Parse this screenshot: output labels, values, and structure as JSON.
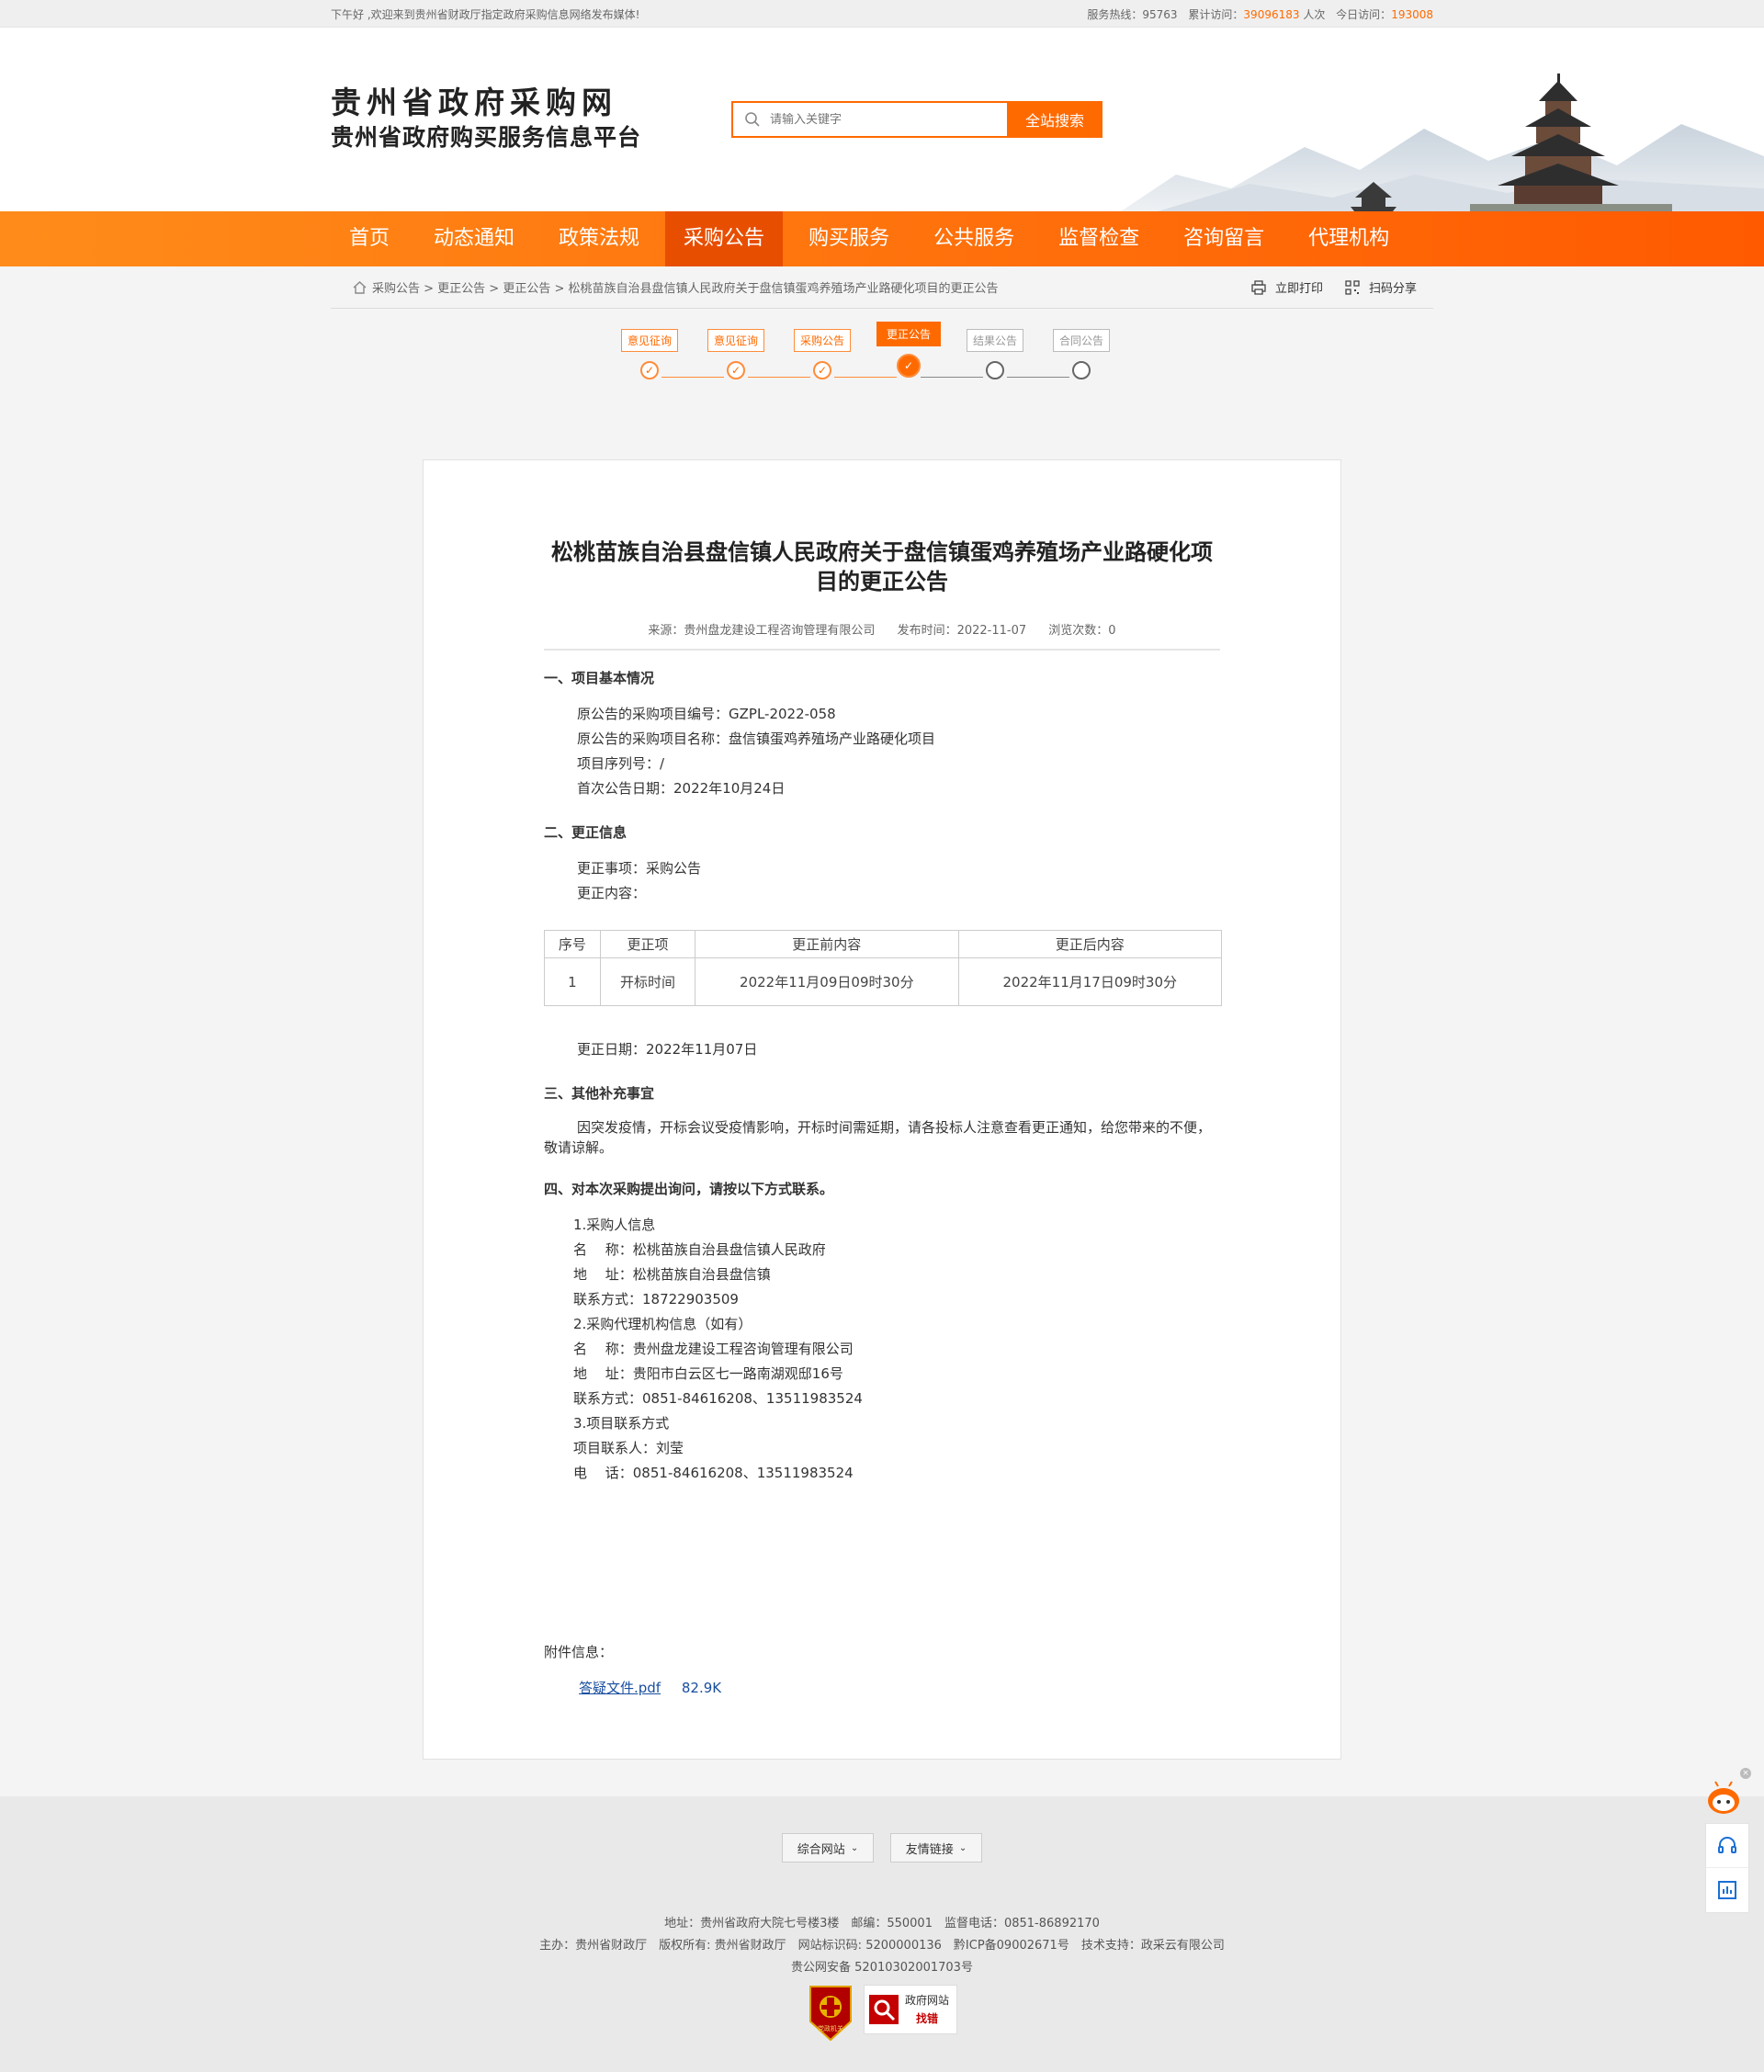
{
  "topbar": {
    "welcome": "下午好 ,欢迎来到贵州省财政厅指定政府采购信息网络发布媒体!",
    "hotline_label": "服务热线：95763",
    "total_label": "累计访问：",
    "total_value": "39096183",
    "total_unit": "人次",
    "today_label": "今日访问：",
    "today_value": "193008"
  },
  "header": {
    "title1": "贵州省政府采购网",
    "title2": "贵州省政府购买服务信息平台",
    "search_placeholder": "请输入关键字",
    "search_button": "全站搜索"
  },
  "nav": {
    "items": [
      "首页",
      "动态通知",
      "政策法规",
      "采购公告",
      "购买服务",
      "公共服务",
      "监督检查",
      "咨询留言",
      "代理机构"
    ],
    "active_index": 3
  },
  "breadcrumb": {
    "path": "采购公告 > 更正公告 > 更正公告 > 松桃苗族自治县盘信镇人民政府关于盘信镇蛋鸡养殖场产业路硬化项目的更正公告",
    "print": "立即打印",
    "share": "扫码分享"
  },
  "progress": {
    "steps": [
      "意见征询",
      "意见征询",
      "采购公告",
      "更正公告",
      "结果公告",
      "合同公告"
    ],
    "current_index": 3,
    "done_count": 3
  },
  "article": {
    "title": "松桃苗族自治县盘信镇人民政府关于盘信镇蛋鸡养殖场产业路硬化项目的更正公告",
    "source": "来源：贵州盘龙建设工程咨询管理有限公司",
    "publish_time": "发布时间：2022-11-07",
    "views": "浏览次数：0",
    "s1_title": "一、项目基本情况",
    "s1_lines": [
      "原公告的采购项目编号：GZPL-2022-058",
      "原公告的采购项目名称：盘信镇蛋鸡养殖场产业路硬化项目",
      "项目序列号：/",
      "首次公告日期：2022年10月24日"
    ],
    "s2_title": "二、更正信息",
    "s2_lines": [
      "更正事项：采购公告",
      "更正内容："
    ],
    "table": {
      "headers": [
        "序号",
        "更正项",
        "更正前内容",
        "更正后内容"
      ],
      "row": [
        "1",
        "开标时间",
        "2022年11月09日09时30分",
        "2022年11月17日09时30分"
      ]
    },
    "change_date": "更正日期：2022年11月07日",
    "s3_title": "三、其他补充事宜",
    "s3_text": "因突发疫情，开标会议受疫情影响，开标时间需延期，请各投标人注意查看更正通知，给您带来的不便，敬请谅解。",
    "s4_title": "四、对本次采购提出询问，请按以下方式联系。",
    "s4_lines": [
      "1.采购人信息",
      "名　 称：松桃苗族自治县盘信镇人民政府",
      "地　 址：松桃苗族自治县盘信镇",
      "联系方式：18722903509",
      "2.采购代理机构信息（如有）",
      "名　 称：贵州盘龙建设工程咨询管理有限公司",
      "地　 址：贵阳市白云区七一路南湖观邸16号",
      "联系方式：0851-84616208、13511983524",
      "3.项目联系方式",
      "项目联系人：刘莹",
      "电　 话：0851-84616208、13511983524"
    ],
    "attach_label": "附件信息：",
    "attach_name": "答疑文件.pdf",
    "attach_size": "82.9K"
  },
  "footer": {
    "drop1": "综合网站",
    "drop2": "友情链接",
    "line1": "地址：贵州省政府大院七号楼3楼　邮编：550001　监督电话：0851-86892170",
    "line2": "主办：贵州省财政厅　版权所有: 贵州省财政厅　网站标识码: 5200000136　黔ICP备09002671号　技术支持：政采云有限公司",
    "line3": "贵公网安备 52010302001703号",
    "badge1_text": "党政机关",
    "badge2_line1": "政府网站",
    "badge2_line2": "找错"
  },
  "colors": {
    "accent": "#ff6a00",
    "link": "#1a4fa0"
  }
}
